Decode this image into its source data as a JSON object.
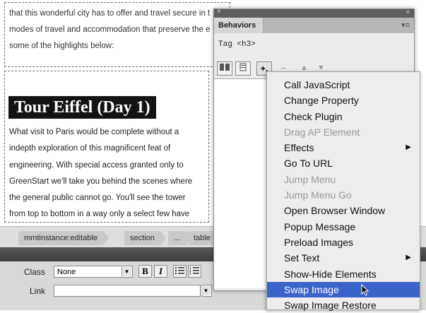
{
  "document": {
    "intro_lines": [
      "that this wonderful city has to offer and travel secure in t",
      "modes of travel and accommodation that preserve the e",
      "some of the highlights below:"
    ],
    "heading": "Tour Eiffel (Day 1)",
    "body_lines": [
      "What visit to Paris would be complete without a",
      "indepth exploration of this magnificent feat of",
      "engineering. With special access granted only to",
      "GreenStart we'll take you behind the scenes where",
      "the general public cannot go. You'll see the tower",
      "from top to bottom in a way only a select few have"
    ]
  },
  "tag_selector": {
    "tags": [
      "mmtinstance:editable",
      "section",
      "...",
      "table"
    ]
  },
  "property_inspector": {
    "class_label": "Class",
    "class_value": "None",
    "bold_label": "B",
    "italic_label": "I",
    "link_label": "Link",
    "link_value": ""
  },
  "behaviors_panel": {
    "tab_label": "Behaviors",
    "tag_label": "Tag <h3>",
    "add_label": "+.",
    "remove_label": "−",
    "up_label": "▲",
    "down_label": "▼"
  },
  "menu": {
    "items": [
      {
        "label": "Call JavaScript",
        "disabled": false,
        "submenu": false
      },
      {
        "label": "Change Property",
        "disabled": false,
        "submenu": false
      },
      {
        "label": "Check Plugin",
        "disabled": false,
        "submenu": false
      },
      {
        "label": "Drag AP Element",
        "disabled": true,
        "submenu": false
      },
      {
        "label": "Effects",
        "disabled": false,
        "submenu": true
      },
      {
        "label": "Go To URL",
        "disabled": false,
        "submenu": false
      },
      {
        "label": "Jump Menu",
        "disabled": true,
        "submenu": false
      },
      {
        "label": "Jump Menu Go",
        "disabled": true,
        "submenu": false
      },
      {
        "label": "Open Browser Window",
        "disabled": false,
        "submenu": false
      },
      {
        "label": "Popup Message",
        "disabled": false,
        "submenu": false
      },
      {
        "label": "Preload Images",
        "disabled": false,
        "submenu": false
      },
      {
        "label": "Set Text",
        "disabled": false,
        "submenu": true
      },
      {
        "label": "Show-Hide Elements",
        "disabled": false,
        "submenu": false
      },
      {
        "label": "Swap Image",
        "disabled": false,
        "submenu": false,
        "selected": true
      },
      {
        "label": "Swap Image Restore",
        "disabled": false,
        "submenu": false
      }
    ]
  },
  "colors": {
    "selection_highlight": "#3a64c8",
    "heading_background": "#131313"
  }
}
